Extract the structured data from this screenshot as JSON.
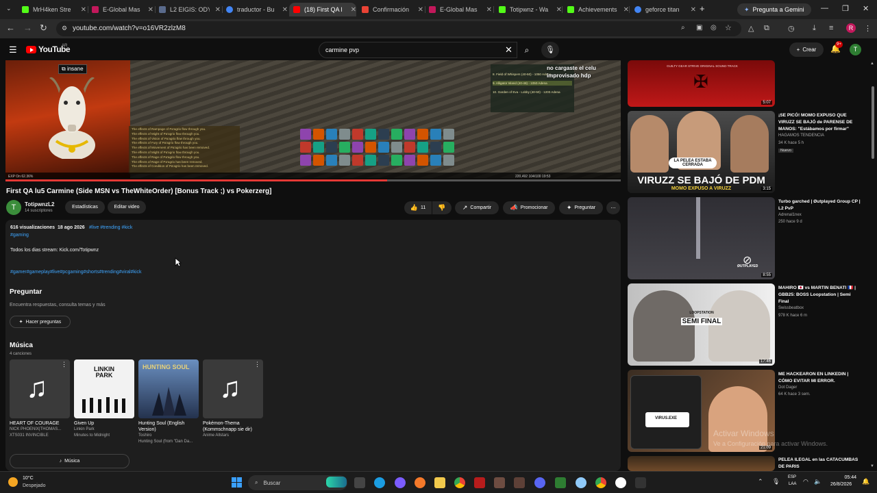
{
  "browser": {
    "tabs": [
      {
        "title": "MrH4ken Stre",
        "color": "#53fc18"
      },
      {
        "title": "E-Global Mas",
        "color": "#c2185b"
      },
      {
        "title": "L2 EIGIS: ODY",
        "color": "#5a6b8c"
      },
      {
        "title": "traductor - Bu",
        "color": "#4285f4"
      },
      {
        "title": "(18) First QA l",
        "color": "#ff0000"
      },
      {
        "title": "Confirmación",
        "color": "#ea4335"
      },
      {
        "title": "E-Global Mas",
        "color": "#c2185b"
      },
      {
        "title": "Totipwnz - Wa",
        "color": "#53fc18"
      },
      {
        "title": "Achievements",
        "color": "#53fc18"
      },
      {
        "title": "geforce titan",
        "color": "#4285f4"
      }
    ],
    "new_tab": "+",
    "gemini_button": "Pregunta a Gemini",
    "url": "youtube.com/watch?v=o16VR2zlzM8",
    "profile_initial": "R"
  },
  "youtube": {
    "logo_text": "YouTube",
    "country": "AR",
    "search_value": "carmine pvp",
    "create_label": "Crear",
    "notif_count": "9+",
    "avatar_initial": "T"
  },
  "player": {
    "insane_label": "insane",
    "overlay_text_1": "no cargaste el celu",
    "overlay_text_2": "improvisado hdp",
    "progress_fraction": 0.62,
    "buffs": [
      "The effects of Rampage of Pa'agrio flow through you.",
      "The effects of Might of Pa'agrio flow through you.",
      "The effects of Vision of Pa'agrio flow through you.",
      "The effects of Fury of Pa'agrio flow through you.",
      "The effects of Movement of Pa'agrio has been removed.",
      "The effects of Might of Pa'agrio flow through you.",
      "The effects of Rage of Pa'agrio flow through you.",
      "The effects of Rage of Pa'agrio has been removed.",
      "The effects of Condition of Pa'agrio has been removed."
    ],
    "map_entries": [
      "8. Field of Whispers (40-50) - 1050 Adena",
      "9. Alligator Island (40-48) - 1050 Adena",
      "10. Garden of Eva - Lobby (40-50) - 1200 Adena"
    ],
    "hud_left": "EXP On   62.36%",
    "hud_right": "220,492       104/100     19:53"
  },
  "video": {
    "title": "First QA lu5 Carmine (Side MSN vs TheWhiteOrder) [Bonus Track ;) vs Pokerzerg]",
    "channel": "TotipwnzL2",
    "subscribers": "14 suscriptores",
    "stats_button": "Estadísticas",
    "edit_button": "Editar video",
    "likes": "11",
    "share_label": "Compartir",
    "promote_label": "Promocionar",
    "ask_label": "Preguntar",
    "more": "⋯"
  },
  "description": {
    "views": "616 visualizaciones",
    "date": "18 ago 2026",
    "tags_inline": "#live #trending #kick",
    "tag_line2": "#gaming",
    "body": "Todos los dias stream: Kick.com/Totipwnz",
    "hashtags": "#gamer#gameplay#live#pcgaming#shorts#trending#viral#kick",
    "ask_heading": "Preguntar",
    "ask_sub": "Encuentra respuestas, consulta temas y más",
    "ask_button": "Hacer preguntas",
    "music_heading": "Música",
    "music_count": "4 canciones",
    "songs": [
      {
        "title": "HEART OF COURAGE",
        "artist": "NICK PHOENIX|THOMAS...",
        "album": "XTS031 INVINCIBLE"
      },
      {
        "title": "Given Up",
        "artist": "Linkin Park",
        "album": "Minutes to Midnight"
      },
      {
        "title": "Hunting Soul (English Version)",
        "artist": "Toshiro",
        "album": "Hunting Soul (from \"Dan Da..."
      },
      {
        "title": "Pokémon-Thema (Kommschnapp sie dir)",
        "artist": "Anime Allstars",
        "album": ""
      }
    ],
    "cover_texts": {
      "linkin": "LINKIN PARK",
      "hunting": "HUNTING SOUL"
    },
    "music_button": "Música"
  },
  "sidebar": [
    {
      "title": "",
      "channel": "",
      "meta": "",
      "duration": "5:07",
      "thumb_text": "GUILTY GEAR STRIVE ORIGINAL SOUND TRACK"
    },
    {
      "title": "¡SE PICÓ! MOMO EXPUSO QUE VIRUZZ SE BAJÓ de PARENSE DE MANOS: \"Estábamos por firmar\"",
      "channel": "HAGAMOS TENDENCIA",
      "meta": "34 K  hace 5 h",
      "badge": "Nuevo",
      "duration": "3:15",
      "thumb_text": "VIRUZZ SE BAJÓ DE PDM",
      "thumb_sub": "MOMO EXPUSO A VIRUZZ",
      "bubble": "LA PELEA ESTABA CERRADA"
    },
    {
      "title": "Turbo garched | Øutplayed Group CP | L2 PvP",
      "channel": "Adrenal1nex",
      "meta": "250  hace 9 d",
      "duration": "8:55",
      "thumb_text": "ØUTPLAYED"
    },
    {
      "title": "MAHIRO 🇯🇵 vs MARTIN BENATI 🇫🇷 | GBB25: BOSS Loopstation | Semi Final",
      "channel": "Swissbeatbox",
      "meta": "978 K  hace 6 m",
      "duration": "17:46",
      "thumb_text": "SEMI FINAL",
      "thumb_sub": "LOOPSTATION"
    },
    {
      "title": "ME HACKEARON EN LINKEDIN | CÓMO EVITAR MI ERROR.",
      "channel": "Dot Dager",
      "meta": "64 K  hace 3 sem.",
      "duration": "21:09",
      "thumb_text": "VIRUS.EXE"
    },
    {
      "title": "PELEA ILEGAL en las CATACUMBAS DE PARIS",
      "channel": "",
      "meta": "",
      "duration": "",
      "thumb_text": ""
    }
  ],
  "watermark": {
    "line1": "Activar Windows",
    "line2": "Ve a Configuración para activar Windows."
  },
  "taskbar": {
    "temp": "10°C",
    "condition": "Despejado",
    "search": "Buscar",
    "lang1": "ESP",
    "lang2": "LAA",
    "time": "05:44",
    "date": "26/8/2026"
  }
}
